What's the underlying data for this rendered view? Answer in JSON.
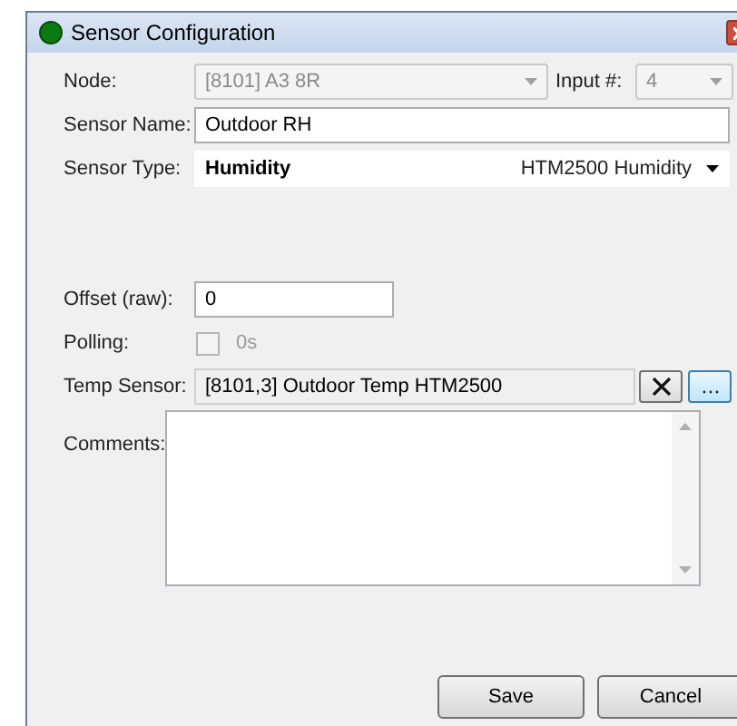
{
  "window": {
    "title": "Sensor Configuration"
  },
  "node": {
    "label": "Node:",
    "value": "[8101] A3 8R",
    "disabled": true
  },
  "input": {
    "label": "Input #:",
    "value": "4",
    "disabled": true
  },
  "sensor_name": {
    "label": "Sensor Name:",
    "value": "Outdoor RH"
  },
  "sensor_type": {
    "label": "Sensor Type:",
    "value": "Humidity",
    "model": "HTM2500 Humidity"
  },
  "offset": {
    "label": "Offset (raw):",
    "value": "0"
  },
  "polling": {
    "label": "Polling:",
    "checked": false,
    "disabled": true,
    "interval": "0s"
  },
  "temp_sensor": {
    "label": "Temp Sensor:",
    "value": "[8101,3] Outdoor Temp HTM2500"
  },
  "comments": {
    "label": "Comments:"
  },
  "buttons": [
    "Save",
    "Cancel"
  ]
}
